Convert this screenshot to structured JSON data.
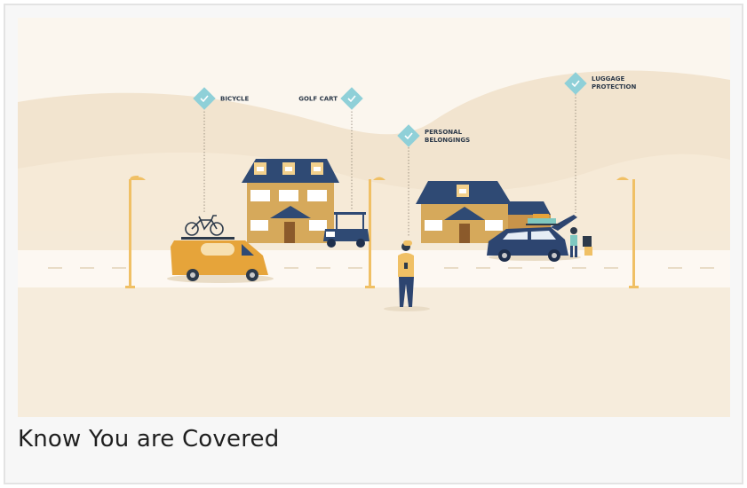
{
  "labels": {
    "bicycle": "BICYCLE",
    "golf_cart": "GOLF CART",
    "personal_line1": "PERSONAL",
    "personal_line2": "BELONGINGS",
    "luggage_line1": "LUGGAGE",
    "luggage_line2": "PROTECTION"
  },
  "caption": "Know You are Covered",
  "icons": {
    "marker": "check-diamond-icon"
  },
  "colors": {
    "sky": "#fbf6ee",
    "hills": "#f2e4cf",
    "road": "#fdf8f2",
    "ground": "#f6ecdc",
    "house_roof": "#2f4a74",
    "house_wall": "#d6a95b",
    "van": "#e6a43a",
    "suv": "#2d4570",
    "marker": "#8fd0d8",
    "lamp": "#f0c065"
  }
}
